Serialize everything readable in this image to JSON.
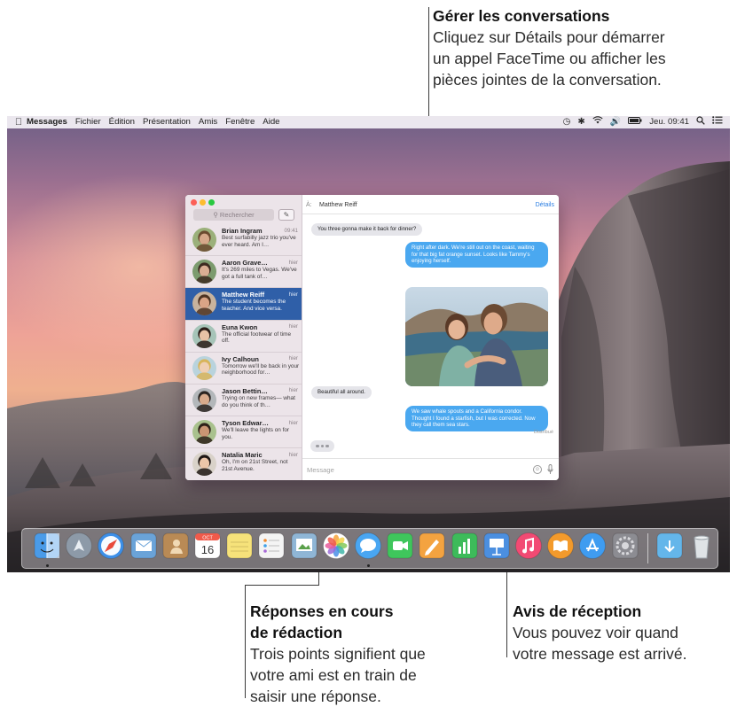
{
  "callouts": {
    "manage": {
      "title": "Gérer les conversations",
      "lines": [
        "Cliquez sur Détails pour démarrer",
        "un appel FaceTime ou afficher les",
        "pièces jointes de la conversation."
      ]
    },
    "typing": {
      "title_lines": [
        "Réponses en cours",
        "de rédaction"
      ],
      "lines": [
        "Trois points signifient que",
        "votre ami est en train de",
        "saisir une réponse."
      ]
    },
    "receipt": {
      "title": "Avis de réception",
      "lines": [
        "Vous pouvez voir quand",
        "votre message est arrivé."
      ]
    }
  },
  "menubar": {
    "app": "Messages",
    "items": [
      "Fichier",
      "Édition",
      "Présentation",
      "Amis",
      "Fenêtre",
      "Aide"
    ],
    "clock": "Jeu. 09:41",
    "status_icons": [
      "time-machine-icon",
      "bluetooth-icon",
      "wifi-icon",
      "volume-icon",
      "battery-icon",
      "spotlight-icon",
      "notification-center-icon"
    ]
  },
  "sidebar": {
    "search_placeholder": "Rechercher",
    "conversations": [
      {
        "name": "Brian Ingram",
        "time": "09:41",
        "preview": "Best surfabilly jazz trio you've ever heard. Am I…",
        "selected": false,
        "skin": "#d6a88a",
        "hair": "#6b4a2f",
        "bg": "#9bb07a"
      },
      {
        "name": "Aaron Grave…",
        "time": "hier",
        "preview": "It's 269 miles to Vegas. We've got a full tank of…",
        "selected": false,
        "skin": "#d9ae93",
        "hair": "#3c2a20",
        "bg": "#7c9b6e"
      },
      {
        "name": "Matthew Reiff",
        "time": "hier",
        "preview": "The student becomes the teacher. And vice versa.",
        "selected": true,
        "skin": "#d9a486",
        "hair": "#4d3322",
        "bg": "#c8b39d"
      },
      {
        "name": "Euna Kwon",
        "time": "hier",
        "preview": "The official footwear of time off.",
        "selected": false,
        "skin": "#e8c2a6",
        "hair": "#2b1d18",
        "bg": "#a6c4b8"
      },
      {
        "name": "Ivy Calhoun",
        "time": "hier",
        "preview": "Tomorrow we'll be back in your neighborhood for…",
        "selected": false,
        "skin": "#efcfb4",
        "hair": "#d8b45a",
        "bg": "#b9d3dd"
      },
      {
        "name": "Jason Bettin…",
        "time": "hier",
        "preview": "Trying on new frames— what do you think of th…",
        "selected": false,
        "skin": "#d8ab8c",
        "hair": "#2a2420",
        "bg": "#b3b7ba"
      },
      {
        "name": "Tyson Edwar…",
        "time": "hier",
        "preview": "We'll leave the lights on for you.",
        "selected": false,
        "skin": "#c99573",
        "hair": "#2d2018",
        "bg": "#a9c18d"
      },
      {
        "name": "Natalia Maric",
        "time": "hier",
        "preview": "Oh, I'm on 21st Street, not 21st Avenue.",
        "selected": false,
        "skin": "#ecc6a9",
        "hair": "#1f1714",
        "bg": "#d9d2c9"
      }
    ]
  },
  "chat": {
    "to_label": "À:",
    "recipient": "Matthew Reiff",
    "details": "Détails",
    "messages": [
      {
        "type": "received",
        "text": "You three gonna make it back for dinner?"
      },
      {
        "type": "sent",
        "text": "Right after dark. We're still out on the coast, waiting for that big fat orange sunset. Looks like Tammy's enjoying herself."
      },
      {
        "type": "sent-photo"
      },
      {
        "type": "received",
        "text": "Beautiful all around."
      },
      {
        "type": "sent",
        "text": "We saw whale spouts and a California condor. Thought I found a starfish, but I was corrected. Now they call them sea stars."
      }
    ],
    "delivered": "Distribué",
    "input_placeholder": "Message"
  },
  "dock": {
    "apps": [
      {
        "name": "finder-icon",
        "color": "#4a9be8",
        "running": true
      },
      {
        "name": "launchpad-icon",
        "color": "#8d9aa8",
        "running": false
      },
      {
        "name": "safari-icon",
        "color": "#3c8fe8",
        "running": false
      },
      {
        "name": "mail-icon",
        "color": "#6aa3d8",
        "running": false
      },
      {
        "name": "contacts-icon",
        "color": "#b98a55",
        "running": false
      },
      {
        "name": "calendar-icon",
        "color": "#ffffff",
        "running": false,
        "label": "16",
        "sublabel": "OCT"
      },
      {
        "name": "notes-icon",
        "color": "#f6e27a",
        "running": false
      },
      {
        "name": "reminders-icon",
        "color": "#f4f4f4",
        "running": false
      },
      {
        "name": "preview-icon",
        "color": "#8fb6d6",
        "running": false
      },
      {
        "name": "photos-icon",
        "color": "#ffffff",
        "running": false
      },
      {
        "name": "messages-icon",
        "color": "#49a6f2",
        "running": true
      },
      {
        "name": "facetime-icon",
        "color": "#3fc65c",
        "running": false
      },
      {
        "name": "pages-icon",
        "color": "#f4a340",
        "running": false
      },
      {
        "name": "numbers-icon",
        "color": "#3dbb5a",
        "running": false
      },
      {
        "name": "keynote-icon",
        "color": "#4b8fe0",
        "running": false
      },
      {
        "name": "itunes-icon",
        "color": "#f24a73",
        "running": false
      },
      {
        "name": "ibooks-icon",
        "color": "#f39a2b",
        "running": false
      },
      {
        "name": "app-store-icon",
        "color": "#3f9cf0",
        "running": false
      },
      {
        "name": "system-preferences-icon",
        "color": "#8c8c92",
        "running": false
      },
      {
        "name": "downloads-folder-icon",
        "color": "#64b6ea",
        "running": false
      },
      {
        "name": "trash-icon",
        "color": "#d7dadd",
        "running": false
      }
    ]
  }
}
